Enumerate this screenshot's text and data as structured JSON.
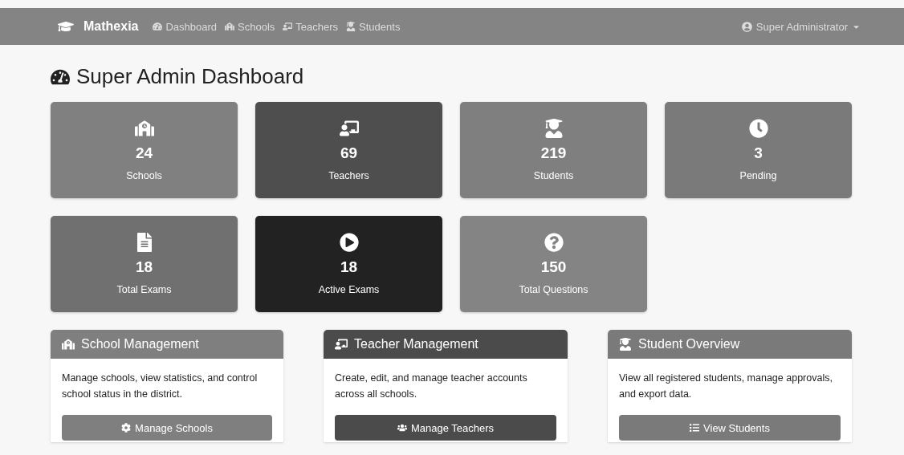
{
  "navbar": {
    "brand": "Mathexia",
    "links": [
      {
        "label": "Dashboard"
      },
      {
        "label": "Schools"
      },
      {
        "label": "Teachers"
      },
      {
        "label": "Students"
      }
    ],
    "user": "Super Administrator"
  },
  "page_title": "Super Admin Dashboard",
  "stats": [
    {
      "value": "24",
      "label": "Schools",
      "color": "#808080"
    },
    {
      "value": "69",
      "label": "Teachers",
      "color": "#4e4e4e"
    },
    {
      "value": "219",
      "label": "Students",
      "color": "#7f7f7f"
    },
    {
      "value": "3",
      "label": "Pending",
      "color": "#7a7a7a"
    },
    {
      "value": "18",
      "label": "Total Exams",
      "color": "#707070"
    },
    {
      "value": "18",
      "label": "Active Exams",
      "color": "#222222"
    },
    {
      "value": "150",
      "label": "Total Questions",
      "color": "#848484"
    }
  ],
  "panels": [
    {
      "title": "School Management",
      "text": "Manage schools, view statistics, and control school status in the district.",
      "button": "Manage Schools",
      "color": "#7f7f7f"
    },
    {
      "title": "Teacher Management",
      "text": "Create, edit, and manage teacher accounts across all schools.",
      "button": "Manage Teachers",
      "color": "#4b4b4b"
    },
    {
      "title": "Student Overview",
      "text": "View all registered students, manage approvals, and export data.",
      "button": "View Students",
      "color": "#7a7a7a"
    }
  ]
}
